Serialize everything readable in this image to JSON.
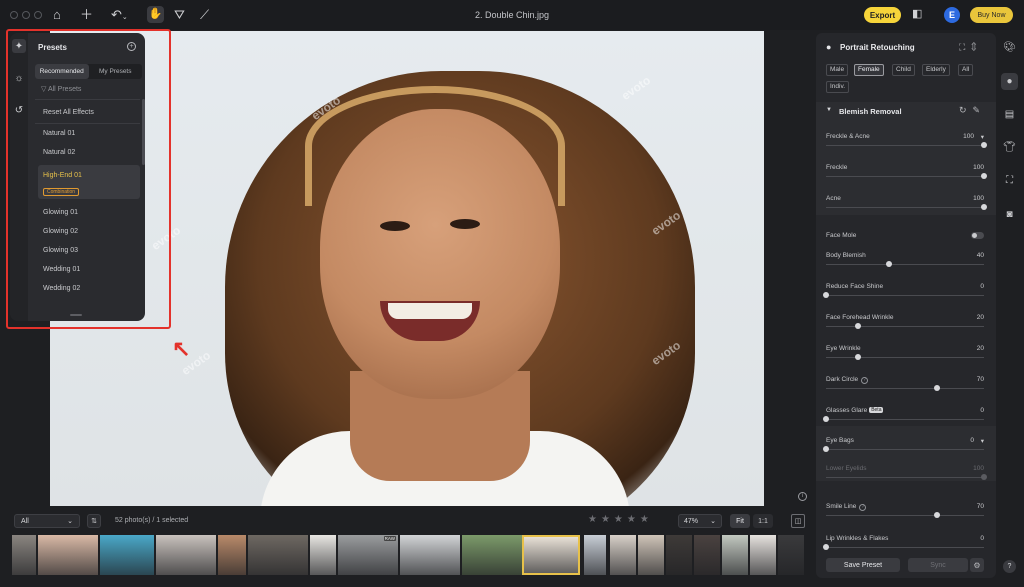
{
  "toolbar": {
    "title": "2. Double Chin.jpg",
    "export_label": "Export",
    "avatar_initial": "E",
    "buy_label": "Buy Now"
  },
  "canvas": {
    "watermark": "evoto"
  },
  "presets": {
    "title": "Presets",
    "tabs": [
      "Recommended",
      "My Presets"
    ],
    "filter_label": "All Presets",
    "items": [
      "Reset All Effects",
      "Natural 01",
      "Natural 02",
      "High-End 01",
      "Glowing 01",
      "Glowing 02",
      "Glowing 03",
      "Wedding 01",
      "Wedding 02"
    ],
    "selected_badge": "Combination"
  },
  "right_panel": {
    "title": "Portrait Retouching",
    "groups": [
      "Male",
      "Female",
      "Child",
      "Elderly",
      "All",
      "Indiv."
    ],
    "selected_group": "Female",
    "section_title": "Blemish Removal",
    "sliders": [
      {
        "label": "Freckle & Acne",
        "value": "100",
        "fraction": 1.0
      },
      {
        "label": "Freckle",
        "value": "100",
        "fraction": 1.0
      },
      {
        "label": "Acne",
        "value": "100",
        "fraction": 1.0
      },
      {
        "label": "Face Mole",
        "value": "",
        "fraction": null
      },
      {
        "label": "Body Blemish",
        "value": "40",
        "fraction": 0.4
      },
      {
        "label": "Reduce Face Shine",
        "value": "0",
        "fraction": 0.0
      },
      {
        "label": "Face Forehead Wrinkle",
        "value": "20",
        "fraction": 0.2
      },
      {
        "label": "Eye Wrinkle",
        "value": "20",
        "fraction": 0.2
      },
      {
        "label": "Dark Circle",
        "value": "70",
        "fraction": 0.7
      },
      {
        "label": "Glasses Glare",
        "value": "0",
        "fraction": 0.0
      },
      {
        "label": "Eye Bags",
        "value": "0",
        "fraction": 0.0
      },
      {
        "label": "Lower Eyelids",
        "value": "100",
        "fraction": 1.0
      },
      {
        "label": "Smile Line",
        "value": "70",
        "fraction": 0.7
      },
      {
        "label": "Lip Wrinkles & Flakes",
        "value": "0",
        "fraction": 0.0
      }
    ],
    "beta_label": "Beta",
    "save_preset_label": "Save Preset",
    "sync_label": "Sync"
  },
  "filmstrip": {
    "filter_value": "All",
    "count_text": "52 photo(s) / 1 selected",
    "zoom_value": "47%",
    "fit_label": "Fit",
    "one_to_one_label": "1:1",
    "raw_badge": "RAW",
    "rating": 0
  },
  "colors": {
    "accent_yellow": "#f6d43a",
    "highlight_red": "#e3322b",
    "avatar_blue": "#2d6ae0",
    "selected_orange": "#e09a30"
  }
}
